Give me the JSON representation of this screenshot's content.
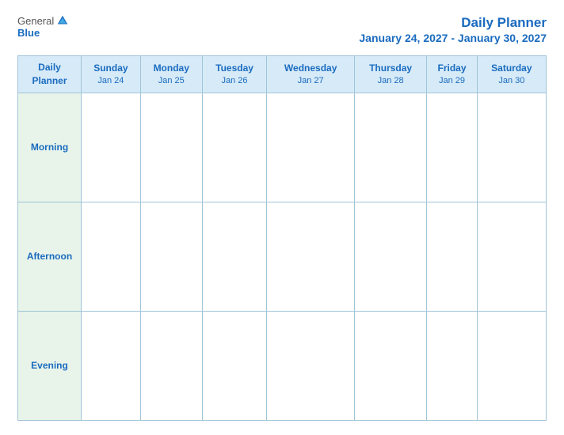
{
  "header": {
    "logo_general": "General",
    "logo_blue": "Blue",
    "planner_title": "Daily Planner",
    "date_range": "January 24, 2027 - January 30, 2027"
  },
  "table": {
    "first_col_header_line1": "Daily",
    "first_col_header_line2": "Planner",
    "days": [
      {
        "name": "Sunday",
        "date": "Jan 24"
      },
      {
        "name": "Monday",
        "date": "Jan 25"
      },
      {
        "name": "Tuesday",
        "date": "Jan 26"
      },
      {
        "name": "Wednesday",
        "date": "Jan 27"
      },
      {
        "name": "Thursday",
        "date": "Jan 28"
      },
      {
        "name": "Friday",
        "date": "Jan 29"
      },
      {
        "name": "Saturday",
        "date": "Jan 30"
      }
    ],
    "time_slots": [
      "Morning",
      "Afternoon",
      "Evening"
    ]
  }
}
